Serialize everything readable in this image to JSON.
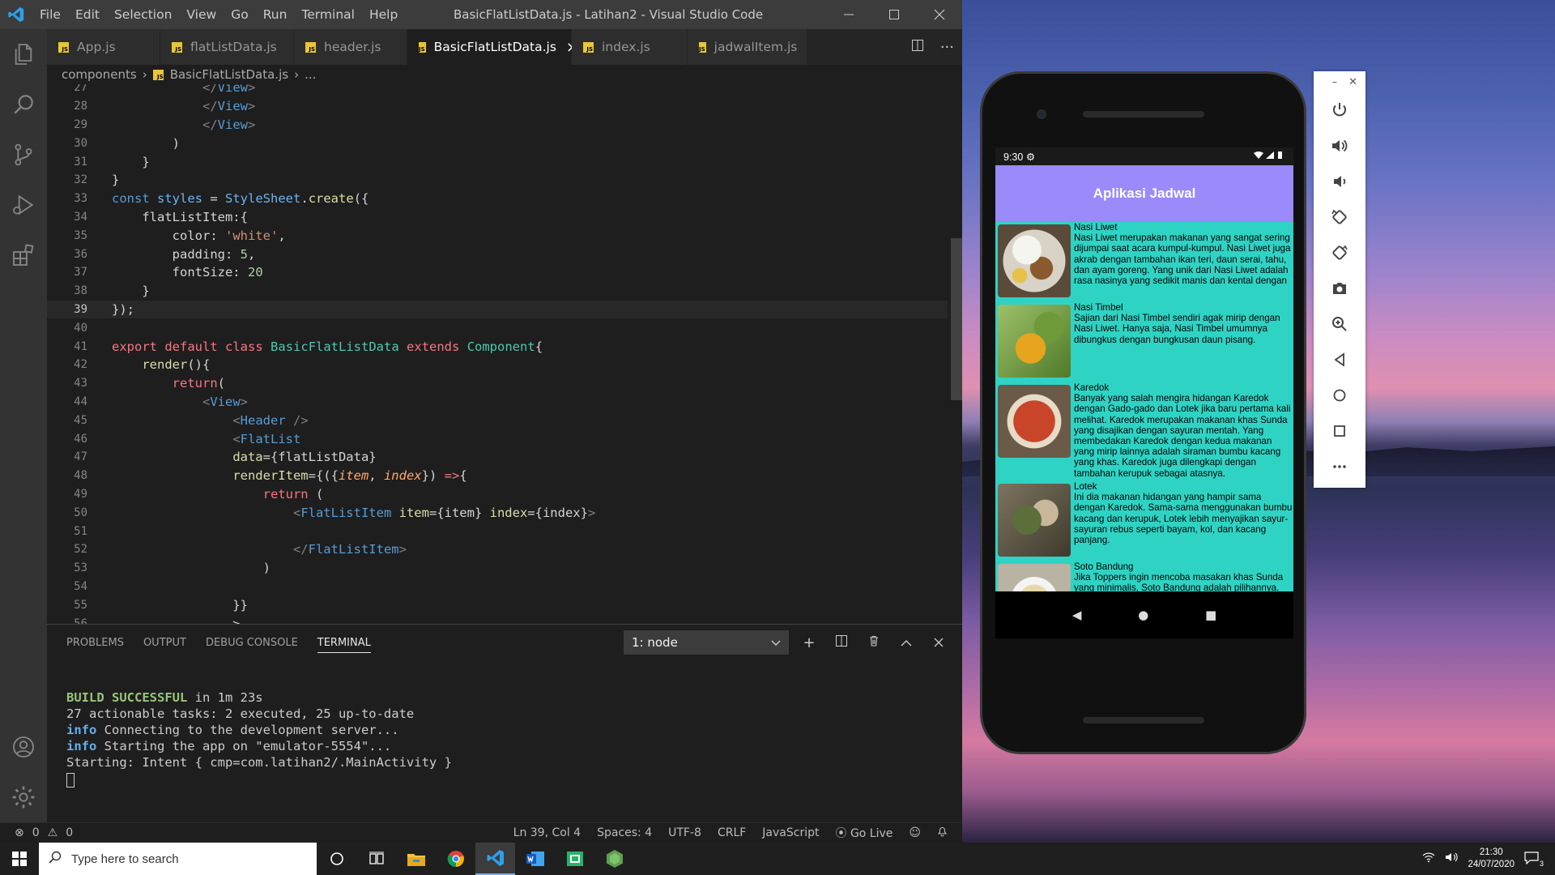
{
  "titlebar": {
    "menu": [
      "File",
      "Edit",
      "Selection",
      "View",
      "Go",
      "Run",
      "Terminal",
      "Help"
    ],
    "title": "BasicFlatListData.js - Latihan2 - Visual Studio Code"
  },
  "tabs": [
    {
      "label": "App.js"
    },
    {
      "label": "flatListData.js"
    },
    {
      "label": "header.js"
    },
    {
      "label": "BasicFlatListData.js"
    },
    {
      "label": "index.js"
    },
    {
      "label": "jadwalItem.js"
    }
  ],
  "tab_badge": "JS",
  "breadcrumb": {
    "folder": "components",
    "file": "BasicFlatListData.js",
    "more": "..."
  },
  "editor": {
    "line_numbers": [
      "27",
      "28",
      "29",
      "30",
      "31",
      "32",
      "33",
      "34",
      "35",
      "36",
      "37",
      "38",
      "39",
      "40",
      "41",
      "42",
      "43",
      "44",
      "45",
      "46",
      "47",
      "48",
      "49",
      "50",
      "51",
      "52",
      "53",
      "54",
      "55",
      "56"
    ],
    "current_line": "39"
  },
  "panel": {
    "tabs": [
      "PROBLEMS",
      "OUTPUT",
      "DEBUG CONSOLE",
      "TERMINAL"
    ],
    "terminal_select": "1: node",
    "terminal": {
      "build_ok": "BUILD SUCCESSFUL",
      "build_time": " in 1m 23s",
      "tasks": "27 actionable tasks: 2 executed, 25 up-to-date",
      "info_label": "info",
      "info1": " Connecting to the development server...",
      "info2": " Starting the app on \"emulator-5554\"...",
      "starting": "Starting: Intent { cmp=com.latihan2/.MainActivity }"
    }
  },
  "statusbar": {
    "errors": "0",
    "warnings": "0",
    "position": "Ln 39, Col 4",
    "spaces": "Spaces: 4",
    "encoding": "UTF-8",
    "eol": "CRLF",
    "language": "JavaScript",
    "golive": "Go Live"
  },
  "phone": {
    "time": "9:30",
    "app_title": "Aplikasi Jadwal",
    "items": [
      {
        "name": "Nasi Liwet",
        "desc": "Nasi Liwet merupakan makanan yang sangat sering dijumpai saat acara kumpul-kumpul. Nasi Liwet juga akrab dengan tambahan ikan teri, daun serai, tahu, dan ayam goreng. Yang unik dari Nasi Liwet adalah rasa nasinya yang sedikit manis dan kental dengan wangi santen kelapa."
      },
      {
        "name": "Nasi Timbel",
        "desc": "Sajian dari Nasi Timbel sendiri agak mirip dengan Nasi Liwet. Hanya saja, Nasi Timbel umumnya dibungkus dengan bungkusan daun pisang."
      },
      {
        "name": "Karedok",
        "desc": "Banyak yang salah mengira hidangan Karedok dengan Gado-gado dan Lotek jika baru pertama kali melihat. Karedok merupakan makanan khas Sunda yang disajikan dengan sayuran mentah. Yang membedakan Karedok dengan kedua makanan yang mirip lainnya adalah siraman bumbu kacang yang khas. Karedok juga dilengkapi dengan tambahan kerupuk sebagai atasnya."
      },
      {
        "name": "Lotek",
        "desc": "Ini dia makanan hidangan yang hampir sama dengan Karedok. Sama-sama menggunakan bumbu kacang dan kerupuk, Lotek lebih menyajikan sayur-sayuran rebus seperti bayam, kol, dan kacang panjang."
      },
      {
        "name": "Soto Bandung",
        "desc": "Jika Toppers ingin mencoba masakan khas Sunda yang minimalis, Soto Bandung adalah pilihannya. Soto Bandung umumnya menggunakan daging sapi has dalam kuah bening. Yang membedakan Soto Bandung dari yang lainnya adalah penambahan kacang kedelai goreng dan juga lobak."
      }
    ]
  },
  "taskbar": {
    "search_placeholder": "Type here to search",
    "time": "21:30",
    "date": "24/07/2020",
    "notifications": "3"
  }
}
